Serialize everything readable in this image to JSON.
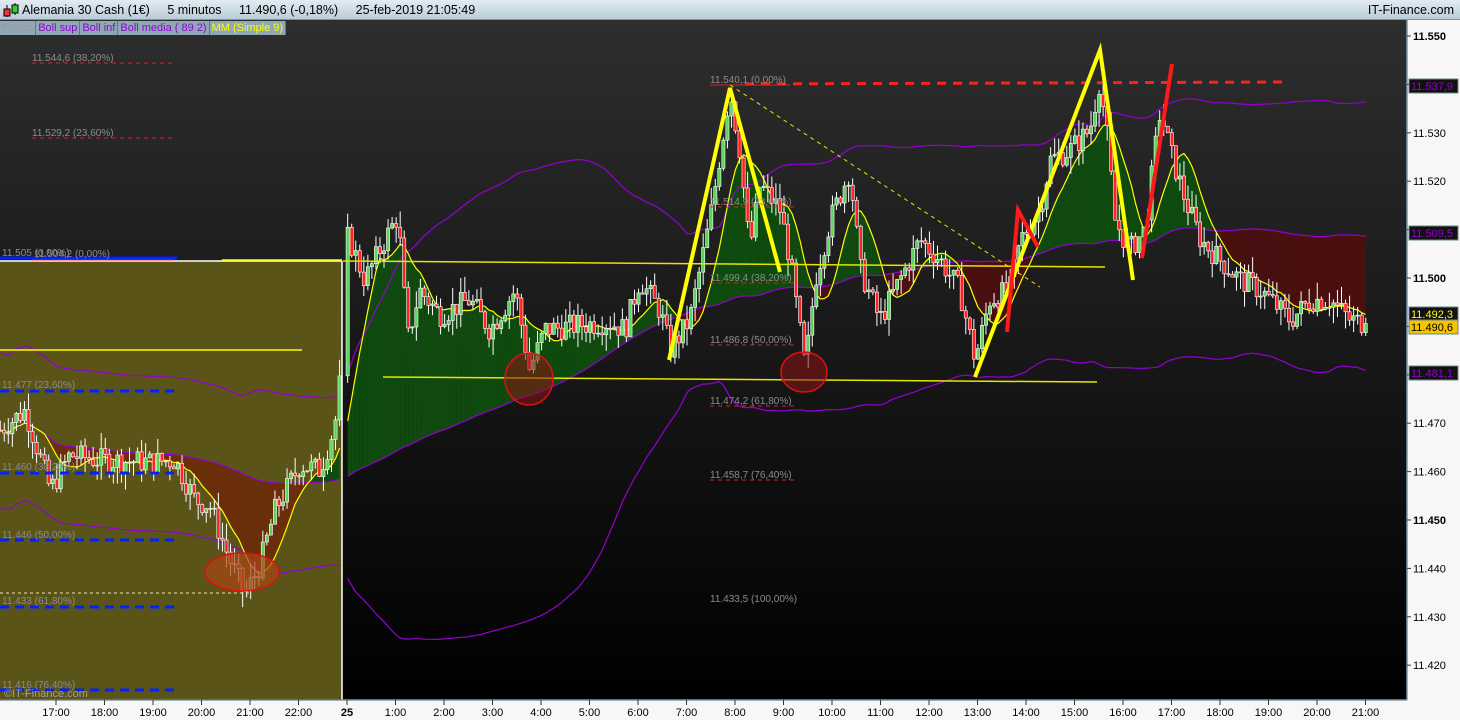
{
  "header": {
    "instrument": "Alemania 30 Cash (1€)",
    "timeframe": "5 minutos",
    "last": "11.490,6 (-0,18%)",
    "datetime": "25-feb-2019 21:05:49",
    "brand": "IT-Finance.com"
  },
  "legend": [
    {
      "label": "Precio",
      "color": "#9a9a9a"
    },
    {
      "label": "Boll sup",
      "color": "#9400d3"
    },
    {
      "label": "Boll inf",
      "color": "#9400d3"
    },
    {
      "label": "Boll media ( 89 2)",
      "color": "#9400d3"
    },
    {
      "label": "MM (Simple 9)",
      "color": "#ffff00"
    }
  ],
  "watermark": "©IT-Finance.com",
  "fib_left": [
    "11.544,6 (38,20%)",
    "11.529,2 (23,60%)",
    "11.505 (0,00%)",
    "11.504,2 (0,00%)",
    "11.477 (23,60%)",
    "11.460 (38,20%)",
    "11.446 (50,00%)",
    "11.433 (61,80%)",
    "11.416 (76,40%)"
  ],
  "fib_right": [
    "11.540,1 (0,00%)",
    "11.514,9 (23,60%)",
    "11.499,4 (38,20%)",
    "11.486,8 (50,00%)",
    "11.474,2 (61,80%)",
    "11.458,7 (76,40%)",
    "11.433,5 (100,00%)"
  ],
  "price_tags": [
    {
      "label": "11.537,9",
      "kind": "boll"
    },
    {
      "label": "11.509,5",
      "kind": "boll"
    },
    {
      "label": "11.492,3",
      "kind": "mm"
    },
    {
      "label": "11.490,6",
      "kind": "last"
    },
    {
      "label": "11.481,1",
      "kind": "boll"
    }
  ],
  "colors": {
    "up": "#5ad45a",
    "down": "#ff2020",
    "boll": "#9400d3",
    "mm": "#ffff00",
    "fill_up": "#0f4a0f",
    "fill_down": "#4a1010",
    "olive_zone": "#5a5418"
  },
  "chart_data": {
    "type": "candlestick",
    "title": "Alemania 30 Cash (1€) 5 minutos",
    "y_ticks": [
      "11.420",
      "11.430",
      "11.440",
      "11.450",
      "11.460",
      "11.470",
      "11.480",
      "11.490",
      "11.500",
      "11.510",
      "11.520",
      "11.530",
      "11.540",
      "11.550"
    ],
    "ylim": [
      11412,
      11556
    ],
    "x_ticks": [
      "17:00",
      "18:00",
      "19:00",
      "20:00",
      "21:00",
      "22:00",
      "25",
      "1:00",
      "2:00",
      "3:00",
      "4:00",
      "5:00",
      "6:00",
      "7:00",
      "8:00",
      "9:00",
      "10:00",
      "11:00",
      "12:00",
      "13:00",
      "14:00",
      "15:00",
      "16:00",
      "17:00",
      "18:00",
      "19:00",
      "20:00",
      "21:00"
    ],
    "grid": false,
    "approx_close_path": [
      [
        "24 15:51",
        11468.6
      ],
      [
        "24 16:22",
        11472.7
      ],
      [
        "24 16:53",
        11456.2
      ],
      [
        "24 17:17",
        11463.4
      ],
      [
        "24 17:54",
        11462.4
      ],
      [
        "24 18:56",
        11462.0
      ],
      [
        "24 19:27",
        11462.4
      ],
      [
        "24 19:52",
        11454.1
      ],
      [
        "24 20:10",
        11453.1
      ],
      [
        "24 20:35",
        11441.7
      ],
      [
        "24 20:54",
        11434.5
      ],
      [
        "24 21:12",
        11440.7
      ],
      [
        "24 21:31",
        11452.1
      ],
      [
        "24 22:02",
        11461.4
      ],
      [
        "24 22:27",
        11460.3
      ],
      [
        "24 22:45",
        11469.6
      ],
      [
        "24 22:53",
        11481.0
      ],
      [
        "25 00:01",
        11508.9
      ],
      [
        "25 00:22",
        11499.6
      ],
      [
        "25 00:47",
        11507.9
      ],
      [
        "25 01:03",
        11513.0
      ],
      [
        "25 01:15",
        11487.2
      ],
      [
        "25 01:30",
        11497.5
      ],
      [
        "25 01:55",
        11492.4
      ],
      [
        "25 02:32",
        11495.5
      ],
      [
        "25 02:57",
        11489.3
      ],
      [
        "25 03:28",
        11497.5
      ],
      [
        "25 03:46",
        11481.0
      ],
      [
        "25 04:05",
        11489.3
      ],
      [
        "25 04:48",
        11490.3
      ],
      [
        "25 05:25",
        11490.9
      ],
      [
        "25 05:44",
        11489.3
      ],
      [
        "25 06:02",
        11499.6
      ],
      [
        "25 06:27",
        11493.4
      ],
      [
        "25 06:40",
        11485.1
      ],
      [
        "25 07:04",
        11491.3
      ],
      [
        "25 07:29",
        11512.0
      ],
      [
        "25 07:54",
        11538.8
      ],
      [
        "25 08:06",
        11526.4
      ],
      [
        "25 08:18",
        11505.8
      ],
      [
        "25 08:31",
        11519.2
      ],
      [
        "25 08:56",
        11514.0
      ],
      [
        "25 09:08",
        11503.7
      ],
      [
        "25 09:27",
        11481.0
      ],
      [
        "25 09:39",
        11499.6
      ],
      [
        "25 09:58",
        11512.0
      ],
      [
        "25 10:22",
        11522.3
      ],
      [
        "25 10:35",
        11501.7
      ],
      [
        "25 10:59",
        11491.3
      ],
      [
        "25 11:24",
        11499.6
      ],
      [
        "25 11:49",
        11507.9
      ],
      [
        "25 12:14",
        11503.7
      ],
      [
        "25 12:38",
        11497.5
      ],
      [
        "25 12:57",
        11483.1
      ],
      [
        "25 13:15",
        11495.5
      ],
      [
        "25 13:40",
        11497.5
      ],
      [
        "25 13:53",
        11507.9
      ],
      [
        "25 14:17",
        11514.0
      ],
      [
        "25 14:30",
        11524.4
      ],
      [
        "25 14:54",
        11526.4
      ],
      [
        "25 15:19",
        11530.6
      ],
      [
        "25 15:31",
        11540.9
      ],
      [
        "25 15:41",
        11528.5
      ],
      [
        "25 15:50",
        11512.0
      ],
      [
        "25 16:08",
        11505.8
      ],
      [
        "25 16:27",
        11509.9
      ],
      [
        "25 16:46",
        11534.7
      ],
      [
        "25 16:58",
        11526.4
      ],
      [
        "25 17:17",
        11516.1
      ],
      [
        "25 17:36",
        11507.9
      ],
      [
        "25 18:00",
        11503.7
      ],
      [
        "25 18:25",
        11499.6
      ],
      [
        "25 18:50",
        11497.5
      ],
      [
        "25 19:27",
        11491.3
      ],
      [
        "25 19:52",
        11495.5
      ],
      [
        "25 20:16",
        11495.5
      ],
      [
        "25 20:41",
        11491.3
      ],
      [
        "25 21:03",
        11490.6
      ]
    ]
  }
}
